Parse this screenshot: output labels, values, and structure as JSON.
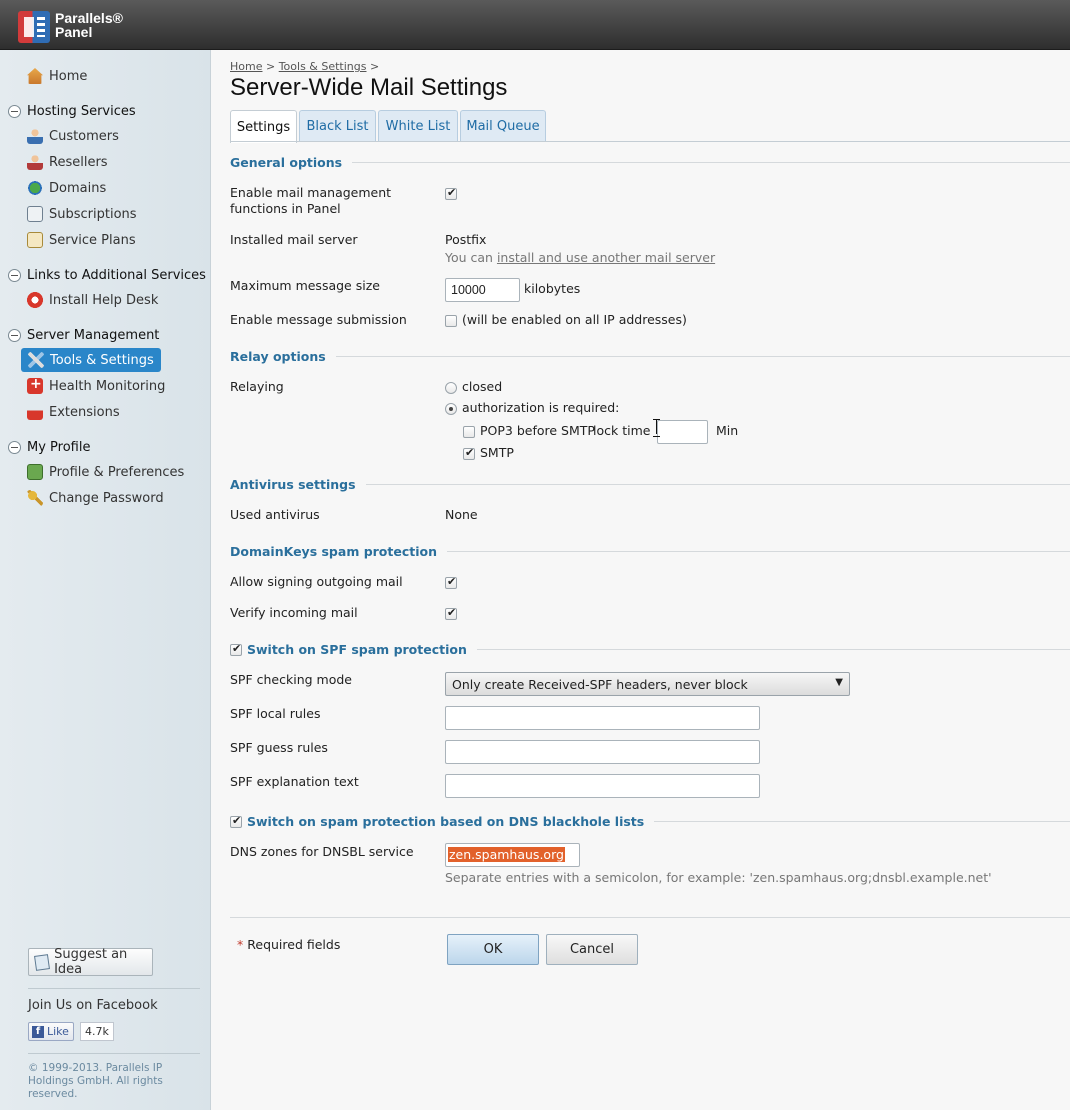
{
  "header": {
    "brand_line1": "Parallels®",
    "brand_line2": "Panel"
  },
  "sidebar": {
    "home": "Home",
    "groups": [
      {
        "title": "Hosting Services",
        "items": [
          "Customers",
          "Resellers",
          "Domains",
          "Subscriptions",
          "Service Plans"
        ]
      },
      {
        "title": "Links to Additional Services",
        "items": [
          "Install Help Desk"
        ]
      },
      {
        "title": "Server Management",
        "items": [
          "Tools & Settings",
          "Health Monitoring",
          "Extensions"
        ]
      },
      {
        "title": "My Profile",
        "items": [
          "Profile & Preferences",
          "Change Password"
        ]
      }
    ],
    "active_item": "Tools & Settings",
    "suggest": "Suggest an Idea",
    "facebook_join": "Join Us on Facebook",
    "like_label": "Like",
    "like_count": "4.7k",
    "copyright": "© 1999-2013. Parallels IP Holdings GmbH. All rights reserved."
  },
  "breadcrumb": {
    "home": "Home",
    "tools": "Tools & Settings",
    "sep": ">"
  },
  "page_title": "Server-Wide Mail Settings",
  "tabs": [
    "Settings",
    "Black List",
    "White List",
    "Mail Queue"
  ],
  "sections": {
    "general": "General options",
    "relay": "Relay options",
    "antivirus": "Antivirus settings",
    "domainkeys": "DomainKeys spam protection",
    "spf": "Switch on SPF spam protection",
    "dnsbl": "Switch on spam protection based on DNS blackhole lists"
  },
  "general": {
    "enable_mgmt_label_1": "Enable mail management",
    "enable_mgmt_label_2": "functions in Panel",
    "enable_mgmt_checked": true,
    "installed_label": "Installed mail server",
    "installed_value": "Postfix",
    "installed_hint_prefix": "You can ",
    "installed_hint_link": "install and use another mail server",
    "max_size_label": "Maximum message size",
    "max_size_value": "10000",
    "max_size_unit": "kilobytes",
    "submission_label": "Enable message submission",
    "submission_hint": "(will be enabled on all IP addresses)",
    "submission_checked": false
  },
  "relay": {
    "label": "Relaying",
    "closed": "closed",
    "auth": "authorization is required:",
    "pop3": "POP3 before SMTP",
    "lock_time": "lock time",
    "lock_unit": "Min",
    "lock_value": "",
    "smtp": "SMTP"
  },
  "antivirus": {
    "label": "Used antivirus",
    "value": "None"
  },
  "domainkeys": {
    "sign_label": "Allow signing outgoing mail",
    "verify_label": "Verify incoming mail"
  },
  "spf": {
    "mode_label": "SPF checking mode",
    "mode_value": "Only create Received-SPF headers, never block",
    "local_label": "SPF local rules",
    "guess_label": "SPF guess rules",
    "explain_label": "SPF explanation text"
  },
  "dnsbl": {
    "zones_label": "DNS zones for DNSBL service",
    "zones_value": "zen.spamhaus.org",
    "hint": "Separate entries with a semicolon, for example: 'zen.spamhaus.org;dnsbl.example.net'"
  },
  "footer": {
    "required": "Required fields",
    "star": "*",
    "ok": "OK",
    "cancel": "Cancel"
  }
}
